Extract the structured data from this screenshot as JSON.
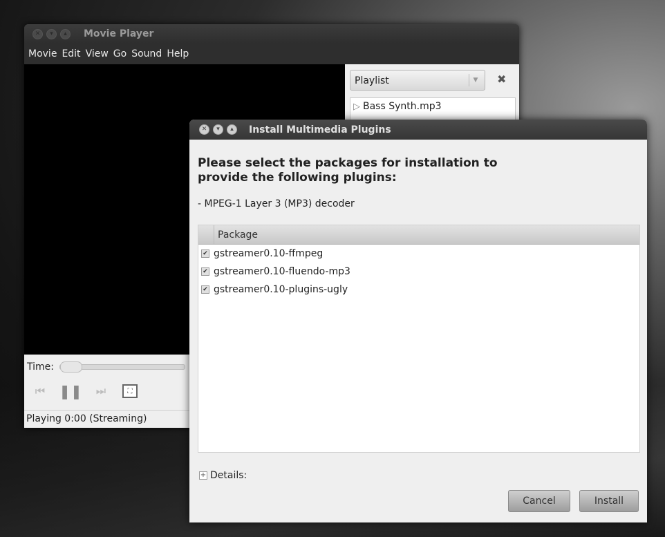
{
  "movie_player": {
    "title": "Movie Player",
    "menu": [
      "Movie",
      "Edit",
      "View",
      "Go",
      "Sound",
      "Help"
    ],
    "time_label": "Time:",
    "status": "Playing  0:00 (Streaming)",
    "playlist": {
      "combo_label": "Playlist",
      "items": [
        "Bass Synth.mp3"
      ]
    }
  },
  "install_dialog": {
    "title": "Install Multimedia Plugins",
    "heading": "Please select the packages for installation to provide the following plugins:",
    "plugin": "- MPEG-1 Layer 3 (MP3) decoder",
    "table": {
      "header": "Package",
      "rows": [
        {
          "name": "gstreamer0.10-ffmpeg",
          "checked": true
        },
        {
          "name": "gstreamer0.10-fluendo-mp3",
          "checked": true
        },
        {
          "name": "gstreamer0.10-plugins-ugly",
          "checked": true
        }
      ]
    },
    "details_label": "Details:",
    "cancel_label": "Cancel",
    "install_label": "Install"
  }
}
